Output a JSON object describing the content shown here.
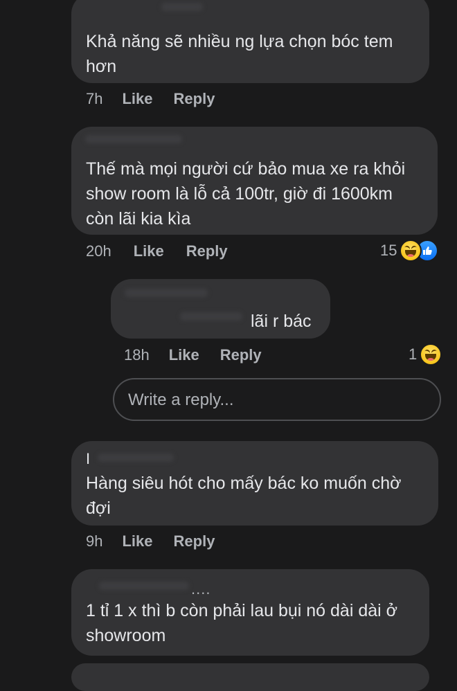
{
  "comments": [
    {
      "text": "Khả năng sẽ nhiều ng lựa chọn bóc tem\nhơn",
      "time": "7h",
      "like_label": "Like",
      "reply_label": "Reply"
    },
    {
      "text": "Thế mà mọi người cứ bảo mua xe ra khỏi\nshow room là lỗ cả 100tr, giờ đi 1600km\ncòn lãi kia kìa",
      "time": "20h",
      "like_label": "Like",
      "reply_label": "Reply",
      "reaction_count": "15",
      "reactions": [
        "haha-icon",
        "like-icon"
      ]
    },
    {
      "text": "lãi r bác",
      "time": "18h",
      "like_label": "Like",
      "reply_label": "Reply",
      "reaction_count": "1",
      "reactions": [
        "haha-icon"
      ]
    },
    {
      "author_initial": "I",
      "text": "Hàng siêu hót cho mấy bác ko muốn chờ\nđợi",
      "time": "9h",
      "like_label": "Like",
      "reply_label": "Reply"
    },
    {
      "author_suffix": "....",
      "text": "1 tỉ 1 x thì b còn phải lau bụi nó dài dài ở\nshowroom"
    }
  ],
  "reply_box": {
    "placeholder": "Write a reply..."
  },
  "colors": {
    "background": "#1a1a1b",
    "bubble": "#333335",
    "meta_text": "#b0b3b8",
    "like_blue": "#0a6ff2",
    "haha_yellow": "#f7c51e"
  }
}
